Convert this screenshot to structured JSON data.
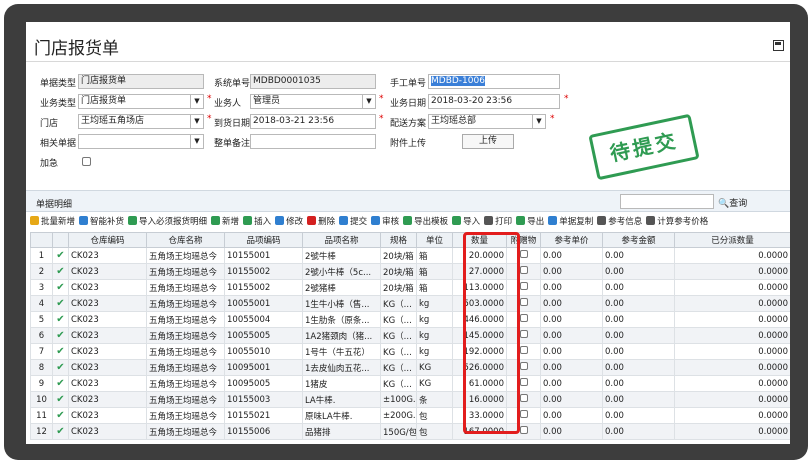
{
  "window": {
    "title": "门店报货单"
  },
  "form": {
    "doc_type_label": "单据类型",
    "doc_type_value": "门店报货单",
    "sys_no_label": "系统单号",
    "sys_no_value": "MDBD0001035",
    "manual_no_label": "手工单号",
    "manual_no_value": "MDBD-1006",
    "biz_type_label": "业务类型",
    "biz_type_value": "门店报货单",
    "salesman_label": "业务人",
    "salesman_value": "管理员",
    "biz_date_label": "业务日期",
    "biz_date_value": "2018-03-20 23:56",
    "store_label": "门店",
    "store_value": "王均瑶五角场店",
    "arrival_label": "到货日期",
    "arrival_value": "2018-03-21 23:56",
    "delivery_label": "配送方案",
    "delivery_value": "王均瑶总部",
    "related_label": "相关单据",
    "related_value": "",
    "remark_label": "整单备注",
    "remark_value": "",
    "attach_label": "附件上传",
    "upload_label": "上传",
    "urgent_label": "加急",
    "required_mark": "*"
  },
  "stamp": {
    "text": "待提交"
  },
  "detail": {
    "title": "单据明细",
    "search_label": "查询",
    "toolbar": [
      {
        "label": "批量新增",
        "color": "#e6a817"
      },
      {
        "label": "智能补货",
        "color": "#2f7fd0"
      },
      {
        "label": "导入必须报货明细",
        "color": "#2f9b52"
      },
      {
        "label": "新增",
        "color": "#2f9b52"
      },
      {
        "label": "插入",
        "color": "#2f9b52"
      },
      {
        "label": "修改",
        "color": "#2f7fd0"
      },
      {
        "label": "删除",
        "color": "#d42020"
      },
      {
        "label": "提交",
        "color": "#2f7fd0"
      },
      {
        "label": "审核",
        "color": "#2f7fd0"
      },
      {
        "label": "导出模板",
        "color": "#2f9b52"
      },
      {
        "label": "导入",
        "color": "#2f9b52"
      },
      {
        "label": "打印",
        "color": "#555555"
      },
      {
        "label": "导出",
        "color": "#2f9b52"
      },
      {
        "label": "单据复制",
        "color": "#2f7fd0"
      },
      {
        "label": "参考信息",
        "color": "#555555"
      },
      {
        "label": "计算参考价格",
        "color": "#555555"
      }
    ],
    "columns": [
      "",
      "",
      "仓库编码",
      "仓库名称",
      "品项编码",
      "品项名称",
      "规格",
      "单位",
      "数量",
      "附赠物",
      "参考单价",
      "参考金额",
      "已分派数量"
    ],
    "rows": [
      {
        "no": "1",
        "wh_code": "CK023",
        "wh_name": "五角场王均瑶总今",
        "item_code": "10155001",
        "item_name": "2號牛棒",
        "spec": "20块/箱",
        "unit": "箱",
        "qty": "20.0000",
        "price": "0.00",
        "amount": "0.00",
        "assigned": "0.0000"
      },
      {
        "no": "2",
        "wh_code": "CK023",
        "wh_name": "五角场王均瑶总今",
        "item_code": "10155002",
        "item_name": "2號小牛棒（5c...",
        "spec": "20块/箱",
        "unit": "箱",
        "qty": "27.0000",
        "price": "0.00",
        "amount": "0.00",
        "assigned": "0.0000"
      },
      {
        "no": "3",
        "wh_code": "CK023",
        "wh_name": "五角场王均瑶总今",
        "item_code": "10155002",
        "item_name": "2號猪棒",
        "spec": "20块/箱",
        "unit": "箱",
        "qty": "113.0000",
        "price": "0.00",
        "amount": "0.00",
        "assigned": "0.0000"
      },
      {
        "no": "4",
        "wh_code": "CK023",
        "wh_name": "五角场王均瑶总今",
        "item_code": "10055001",
        "item_name": "1生牛小棒（售...",
        "spec": "KG（...",
        "unit": "kg",
        "qty": "503.0000",
        "price": "0.00",
        "amount": "0.00",
        "assigned": "0.0000"
      },
      {
        "no": "5",
        "wh_code": "CK023",
        "wh_name": "五角场王均瑶总今",
        "item_code": "10055004",
        "item_name": "1生肋条（原条...",
        "spec": "KG（...",
        "unit": "kg",
        "qty": "446.0000",
        "price": "0.00",
        "amount": "0.00",
        "assigned": "0.0000"
      },
      {
        "no": "6",
        "wh_code": "CK023",
        "wh_name": "五角场王均瑶总今",
        "item_code": "10055005",
        "item_name": "1A2猪颈肉（猪...",
        "spec": "KG（...",
        "unit": "kg",
        "qty": "145.0000",
        "price": "0.00",
        "amount": "0.00",
        "assigned": "0.0000"
      },
      {
        "no": "7",
        "wh_code": "CK023",
        "wh_name": "五角场王均瑶总今",
        "item_code": "10055010",
        "item_name": "1号牛（牛五花）",
        "spec": "KG（...",
        "unit": "kg",
        "qty": "192.0000",
        "price": "0.00",
        "amount": "0.00",
        "assigned": "0.0000"
      },
      {
        "no": "8",
        "wh_code": "CK023",
        "wh_name": "五角场王均瑶总今",
        "item_code": "10095001",
        "item_name": "1去皮仙肉五花...",
        "spec": "KG（...",
        "unit": "KG",
        "qty": "526.0000",
        "price": "0.00",
        "amount": "0.00",
        "assigned": "0.0000"
      },
      {
        "no": "9",
        "wh_code": "CK023",
        "wh_name": "五角场王均瑶总今",
        "item_code": "10095005",
        "item_name": "1猪皮",
        "spec": "KG（...",
        "unit": "KG",
        "qty": "61.0000",
        "price": "0.00",
        "amount": "0.00",
        "assigned": "0.0000"
      },
      {
        "no": "10",
        "wh_code": "CK023",
        "wh_name": "五角场王均瑶总今",
        "item_code": "10155003",
        "item_name": "LA牛棒.",
        "spec": "±100G...",
        "unit": "条",
        "qty": "16.0000",
        "price": "0.00",
        "amount": "0.00",
        "assigned": "0.0000"
      },
      {
        "no": "11",
        "wh_code": "CK023",
        "wh_name": "五角场王均瑶总今",
        "item_code": "10155021",
        "item_name": "原味LA牛棒.",
        "spec": "±200G...",
        "unit": "包",
        "qty": "33.0000",
        "price": "0.00",
        "amount": "0.00",
        "assigned": "0.0000"
      },
      {
        "no": "12",
        "wh_code": "CK023",
        "wh_name": "五角场王均瑶总今",
        "item_code": "10155006",
        "item_name": "品猪排",
        "spec": "150G/包",
        "unit": "包",
        "qty": "167.0000",
        "price": "0.00",
        "amount": "0.00",
        "assigned": "0.0000"
      }
    ]
  }
}
